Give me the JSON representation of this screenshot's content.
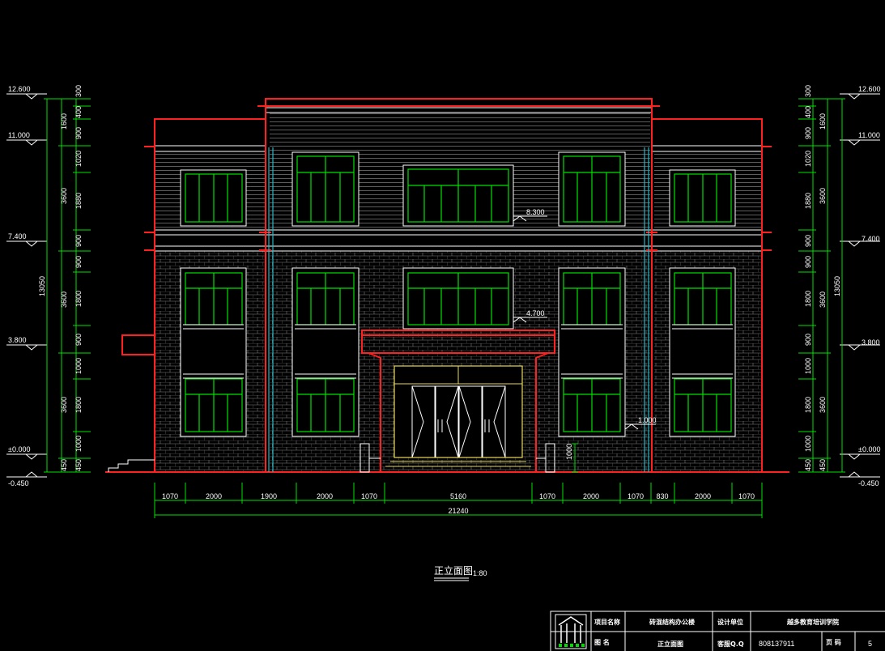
{
  "drawing": {
    "title": "正立面图",
    "scale": "1:80",
    "elevations_left": [
      "12.600",
      "11.000",
      "7.400",
      "3.800",
      "±0.000",
      "-0.450"
    ],
    "elevations_right": [
      "12.600",
      "11.000",
      "7.400",
      "3.800",
      "±0.000",
      "-0.450"
    ],
    "inner_elevations": [
      "8.300",
      "4.700",
      "1.000"
    ],
    "vertical_dims_left": [
      "300",
      "400",
      "900",
      "1020",
      "1880",
      "900",
      "900",
      "1800",
      "900",
      "1000",
      "1800",
      "1000",
      "450",
      "1600",
      "3600",
      "3600",
      "3600",
      "450",
      "13050"
    ],
    "vertical_dims_right": [
      "300",
      "400",
      "900",
      "1020",
      "1880",
      "900",
      "900",
      "1800",
      "900",
      "1000",
      "1800",
      "1000",
      "450",
      "1600",
      "3600",
      "3600",
      "3600",
      "450",
      "13050"
    ],
    "horizontal_dims": [
      "1070",
      "2000",
      "1900",
      "2000",
      "1070",
      "5160",
      "1070",
      "2000",
      "1070",
      "830",
      "2000",
      "1070"
    ],
    "total_width": "21240",
    "step_dim": "1000"
  },
  "title_block": {
    "project_label": "项目名称",
    "project_value": "砖混结构办公楼",
    "design_label": "设计单位",
    "design_value": "越多教育培训学院",
    "drawing_label": "图    名",
    "drawing_value": "正立面图",
    "qq_label": "客服Q.Q",
    "qq_value": "808137911",
    "page_label": "页    码",
    "page_value": "5"
  }
}
